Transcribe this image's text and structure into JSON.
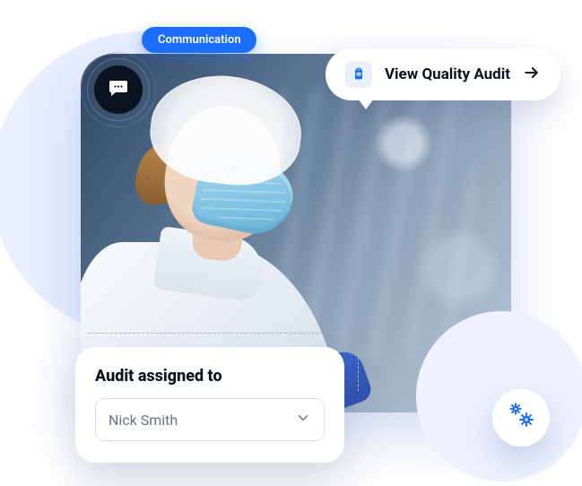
{
  "colors": {
    "primary": "#1a6dff",
    "text": "#0b1220",
    "muted": "#6b7280"
  },
  "communication_badge": {
    "label": "Communication"
  },
  "chat_icon": "chat",
  "view_bubble": {
    "icon": "clipboard",
    "label": "View Quality Audit",
    "action_icon": "arrow-right"
  },
  "assign_panel": {
    "title": "Audit assigned to",
    "select": {
      "value": "Nick Smith",
      "chevron": "down"
    }
  },
  "gear_button": {
    "icon": "gears"
  }
}
